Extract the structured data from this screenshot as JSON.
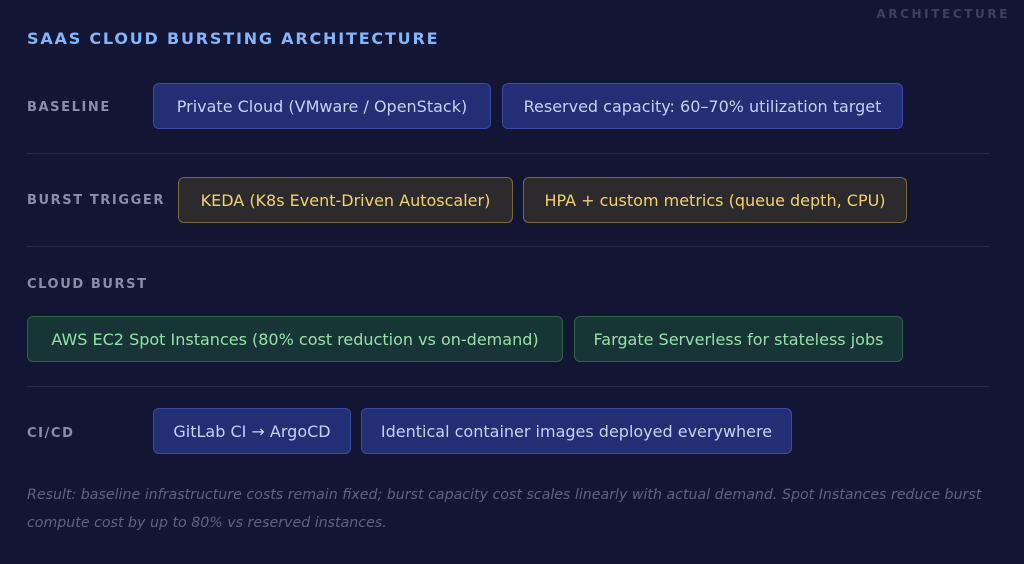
{
  "corner_label": "ARCHITECTURE",
  "title": "SAAS CLOUD BURSTING ARCHITECTURE",
  "rows": [
    {
      "label": "BASELINE",
      "chips": [
        "Private Cloud (VMware / OpenStack)",
        "Reserved capacity: 60–70% utilization target"
      ]
    },
    {
      "label": "BURST TRIGGER",
      "chips": [
        "KEDA (K8s Event-Driven Autoscaler)",
        "HPA + custom metrics (queue depth, CPU)"
      ]
    },
    {
      "label": "CLOUD BURST",
      "chips": [
        "AWS EC2 Spot Instances (80% cost reduction vs on-demand)",
        "Fargate Serverless for stateless jobs"
      ]
    },
    {
      "label": "CI/CD",
      "chips": [
        "GitLab CI → ArgoCD",
        "Identical container images deployed everywhere"
      ]
    }
  ],
  "note": "Result: baseline infrastructure costs remain fixed; burst capacity cost scales linearly with actual demand. Spot Instances reduce burst compute cost by up to 80% vs reserved instances.",
  "colors": {
    "background": "#121632",
    "title": "#7fb6ff",
    "baseline_chip": "#242e74",
    "trigger_chip_text": "#f4d35e",
    "burst_chip_text": "#8fe3a9"
  }
}
